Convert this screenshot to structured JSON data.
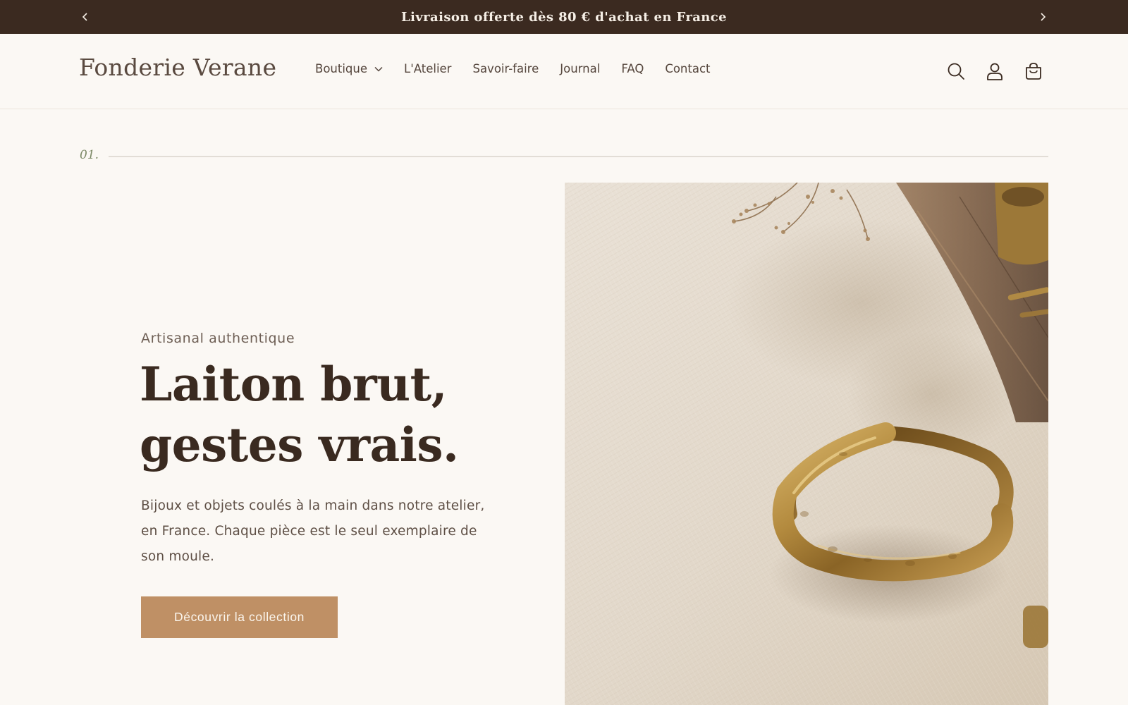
{
  "announcement": {
    "text": "Livraison offerte dès 80 € d'achat en France",
    "prev_icon": "chevron-left-icon",
    "next_icon": "chevron-right-icon"
  },
  "header": {
    "logo": "Fonderie Verane",
    "nav": [
      {
        "label": "Boutique",
        "has_dropdown": true
      },
      {
        "label": "L'Atelier"
      },
      {
        "label": "Savoir-faire"
      },
      {
        "label": "Journal"
      },
      {
        "label": "FAQ"
      },
      {
        "label": "Contact"
      }
    ],
    "icons": [
      "search-icon",
      "account-icon",
      "cart-icon"
    ]
  },
  "hero": {
    "section_number": "01.",
    "eyebrow": "Artisanal authentique",
    "title_line1": "Laiton brut,",
    "title_line2": "gestes vrais.",
    "body": "Bijoux et objets coulés à la main dans notre atelier, en France. Chaque pièce est le seul exemplaire de son moule.",
    "cta_label": "Découvrir la collection",
    "image": "brass-cuff-bracelet-photo"
  },
  "colors": {
    "announcement_bg": "#3b2a20",
    "page_bg": "#fbf8f4",
    "text_dark": "#3a2a20",
    "accent": "#bf9065",
    "section_num": "#7d8a67"
  }
}
